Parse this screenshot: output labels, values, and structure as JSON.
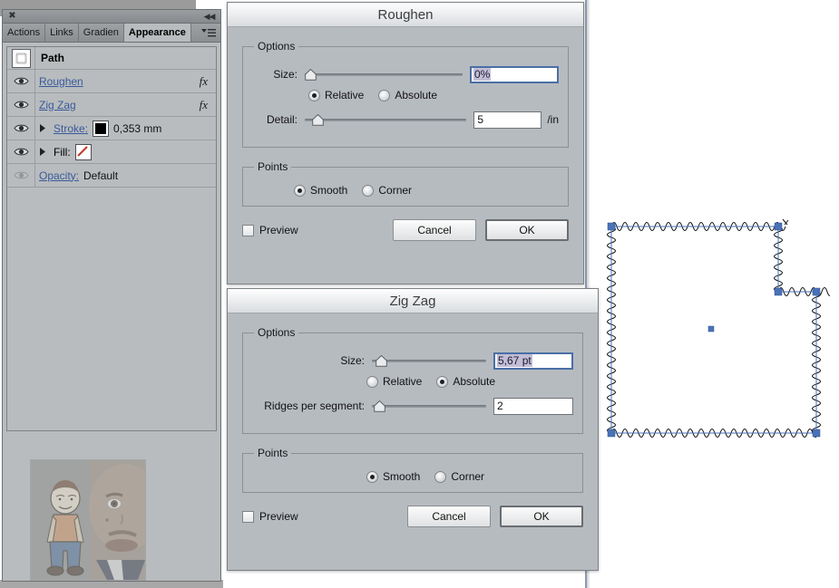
{
  "panel": {
    "close_icon": "close-x",
    "collapse_icon": "double-chevron-left",
    "menu_icon": "panel-menu",
    "tabs": [
      {
        "label": "Actions",
        "active": false
      },
      {
        "label": "Links",
        "active": false
      },
      {
        "label": "Gradien",
        "active": false
      },
      {
        "label": "Appearance",
        "active": true
      }
    ],
    "rows": {
      "path_title": "Path",
      "roughen": {
        "label": "Roughen",
        "fx": "fx"
      },
      "zigzag": {
        "label": "Zig Zag",
        "fx": "fx"
      },
      "stroke": {
        "label": "Stroke:",
        "value": "0,353 mm"
      },
      "fill": {
        "label": "Fill:",
        "value": ""
      },
      "opacity": {
        "label": "Opacity:",
        "value": "Default"
      }
    }
  },
  "roughen_dialog": {
    "title": "Roughen",
    "options_legend": "Options",
    "size_label": "Size:",
    "size_value": "0%",
    "size_slider_percent": 0,
    "relative_label": "Relative",
    "absolute_label": "Absolute",
    "mode_selected": "Relative",
    "detail_label": "Detail:",
    "detail_value": "5",
    "detail_unit": "/in",
    "detail_slider_percent": 4,
    "points_legend": "Points",
    "smooth_label": "Smooth",
    "corner_label": "Corner",
    "points_selected": "Smooth",
    "preview_label": "Preview",
    "preview_checked": false,
    "cancel_label": "Cancel",
    "ok_label": "OK"
  },
  "zigzag_dialog": {
    "title": "Zig Zag",
    "options_legend": "Options",
    "size_label": "Size:",
    "size_value": "5,67 pt",
    "size_slider_percent": 2,
    "relative_label": "Relative",
    "absolute_label": "Absolute",
    "mode_selected": "Absolute",
    "ridges_label": "Ridges per segment:",
    "ridges_value": "2",
    "ridges_slider_percent": 2,
    "points_legend": "Points",
    "smooth_label": "Smooth",
    "corner_label": "Corner",
    "points_selected": "Smooth",
    "preview_label": "Preview",
    "preview_checked": false,
    "cancel_label": "Cancel",
    "ok_label": "OK"
  },
  "artwork": {
    "name": "zigzag-path-selection",
    "stroke_color": "#1b1b1b",
    "anchor_color": "#4a72b8"
  }
}
